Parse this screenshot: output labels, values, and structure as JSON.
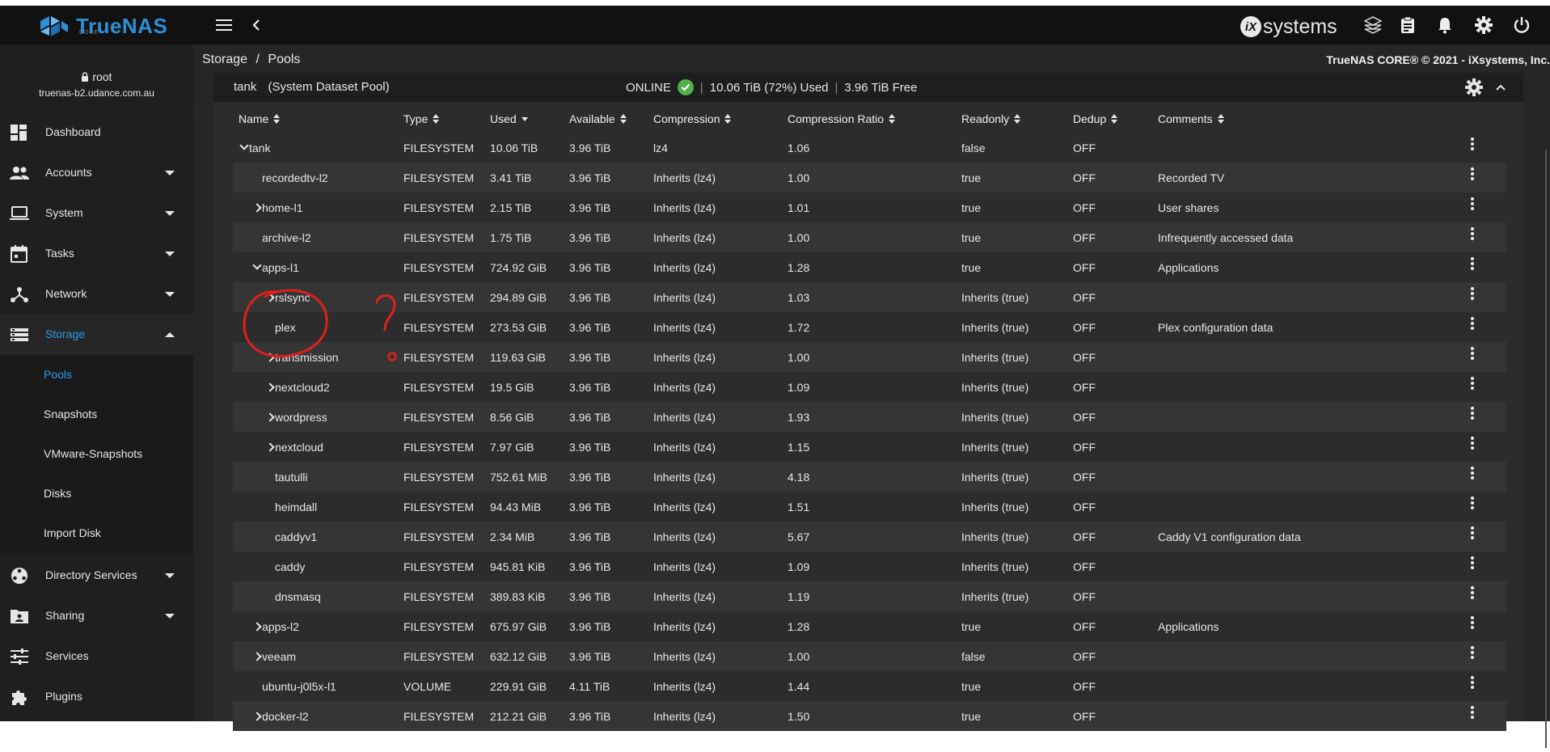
{
  "app": {
    "logo_text": "TrueNAS",
    "logo_sub": "CORE",
    "vendor_logo": "systems",
    "vendor_logo_mark": "iX"
  },
  "topbar": {
    "icons": [
      "menu-icon",
      "chevron-left-icon",
      "truecommand-icon",
      "clipboard-icon",
      "bell-icon",
      "gear-icon",
      "power-icon"
    ]
  },
  "user": {
    "name": "root",
    "host": "truenas-b2.udance.com.au"
  },
  "sidebar": {
    "items": [
      {
        "label": "Dashboard",
        "icon": "dashboard-icon",
        "has_caret": false
      },
      {
        "label": "Accounts",
        "icon": "accounts-icon",
        "has_caret": true
      },
      {
        "label": "System",
        "icon": "laptop-icon",
        "has_caret": true
      },
      {
        "label": "Tasks",
        "icon": "calendar-icon",
        "has_caret": true
      },
      {
        "label": "Network",
        "icon": "network-icon",
        "has_caret": true
      },
      {
        "label": "Storage",
        "icon": "storage-icon",
        "has_caret": true,
        "active": true
      }
    ],
    "storage_sub": [
      "Pools",
      "Snapshots",
      "VMware-Snapshots",
      "Disks",
      "Import Disk"
    ],
    "items_after": [
      {
        "label": "Directory Services",
        "icon": "directory-icon",
        "has_caret": true
      },
      {
        "label": "Sharing",
        "icon": "sharing-icon",
        "has_caret": true
      },
      {
        "label": "Services",
        "icon": "services-icon",
        "has_caret": false
      },
      {
        "label": "Plugins",
        "icon": "plugins-icon",
        "has_caret": false
      }
    ]
  },
  "breadcrumb": {
    "parent": "Storage",
    "separator": "/",
    "current": "Pools"
  },
  "copyright": "TrueNAS CORE® © 2021 - iXsystems, Inc.",
  "pool": {
    "name": "tank",
    "label": "(System Dataset Pool)",
    "status": "ONLINE",
    "used": "10.06 TiB (72%) Used",
    "free": "3.96 TiB Free"
  },
  "table": {
    "columns": [
      "Name",
      "Type",
      "Used",
      "Available",
      "Compression",
      "Compression Ratio",
      "Readonly",
      "Dedup",
      "Comments"
    ],
    "rows": [
      {
        "name": "tank",
        "expander": "down",
        "indent": 0,
        "type": "FILESYSTEM",
        "used": "10.06 TiB",
        "available": "3.96 TiB",
        "compression": "lz4",
        "ratio": "1.06",
        "readonly": "false",
        "dedup": "OFF",
        "comments": ""
      },
      {
        "name": "recordedtv-l2",
        "expander": "none",
        "indent": 1,
        "type": "FILESYSTEM",
        "used": "3.41 TiB",
        "available": "3.96 TiB",
        "compression": "Inherits (lz4)",
        "ratio": "1.00",
        "readonly": "true",
        "dedup": "OFF",
        "comments": "Recorded TV"
      },
      {
        "name": "home-l1",
        "expander": "right",
        "indent": 1,
        "type": "FILESYSTEM",
        "used": "2.15 TiB",
        "available": "3.96 TiB",
        "compression": "Inherits (lz4)",
        "ratio": "1.01",
        "readonly": "true",
        "dedup": "OFF",
        "comments": "User shares"
      },
      {
        "name": "archive-l2",
        "expander": "none",
        "indent": 1,
        "type": "FILESYSTEM",
        "used": "1.75 TiB",
        "available": "3.96 TiB",
        "compression": "Inherits (lz4)",
        "ratio": "1.00",
        "readonly": "true",
        "dedup": "OFF",
        "comments": "Infrequently accessed data"
      },
      {
        "name": "apps-l1",
        "expander": "down",
        "indent": 1,
        "type": "FILESYSTEM",
        "used": "724.92 GiB",
        "available": "3.96 TiB",
        "compression": "Inherits (lz4)",
        "ratio": "1.28",
        "readonly": "true",
        "dedup": "OFF",
        "comments": "Applications"
      },
      {
        "name": "rslsync",
        "expander": "right",
        "indent": 2,
        "type": "FILESYSTEM",
        "used": "294.89 GiB",
        "available": "3.96 TiB",
        "compression": "Inherits (lz4)",
        "ratio": "1.03",
        "readonly": "Inherits (true)",
        "dedup": "OFF",
        "comments": ""
      },
      {
        "name": "plex",
        "expander": "none",
        "indent": 2,
        "type": "FILESYSTEM",
        "used": "273.53 GiB",
        "available": "3.96 TiB",
        "compression": "Inherits (lz4)",
        "ratio": "1.72",
        "readonly": "Inherits (true)",
        "dedup": "OFF",
        "comments": "Plex configuration data"
      },
      {
        "name": "transmission",
        "expander": "right",
        "indent": 2,
        "type": "FILESYSTEM",
        "used": "119.63 GiB",
        "available": "3.96 TiB",
        "compression": "Inherits (lz4)",
        "ratio": "1.00",
        "readonly": "Inherits (true)",
        "dedup": "OFF",
        "comments": ""
      },
      {
        "name": "nextcloud2",
        "expander": "right",
        "indent": 2,
        "type": "FILESYSTEM",
        "used": "19.5 GiB",
        "available": "3.96 TiB",
        "compression": "Inherits (lz4)",
        "ratio": "1.09",
        "readonly": "Inherits (true)",
        "dedup": "OFF",
        "comments": ""
      },
      {
        "name": "wordpress",
        "expander": "right",
        "indent": 2,
        "type": "FILESYSTEM",
        "used": "8.56 GiB",
        "available": "3.96 TiB",
        "compression": "Inherits (lz4)",
        "ratio": "1.93",
        "readonly": "Inherits (true)",
        "dedup": "OFF",
        "comments": ""
      },
      {
        "name": "nextcloud",
        "expander": "right",
        "indent": 2,
        "type": "FILESYSTEM",
        "used": "7.97 GiB",
        "available": "3.96 TiB",
        "compression": "Inherits (lz4)",
        "ratio": "1.15",
        "readonly": "Inherits (true)",
        "dedup": "OFF",
        "comments": ""
      },
      {
        "name": "tautulli",
        "expander": "none",
        "indent": 2,
        "type": "FILESYSTEM",
        "used": "752.61 MiB",
        "available": "3.96 TiB",
        "compression": "Inherits (lz4)",
        "ratio": "4.18",
        "readonly": "Inherits (true)",
        "dedup": "OFF",
        "comments": ""
      },
      {
        "name": "heimdall",
        "expander": "none",
        "indent": 2,
        "type": "FILESYSTEM",
        "used": "94.43 MiB",
        "available": "3.96 TiB",
        "compression": "Inherits (lz4)",
        "ratio": "1.51",
        "readonly": "Inherits (true)",
        "dedup": "OFF",
        "comments": ""
      },
      {
        "name": "caddyv1",
        "expander": "none",
        "indent": 2,
        "type": "FILESYSTEM",
        "used": "2.34 MiB",
        "available": "3.96 TiB",
        "compression": "Inherits (lz4)",
        "ratio": "5.67",
        "readonly": "Inherits (true)",
        "dedup": "OFF",
        "comments": "Caddy V1 configuration data"
      },
      {
        "name": "caddy",
        "expander": "none",
        "indent": 2,
        "type": "FILESYSTEM",
        "used": "945.81 KiB",
        "available": "3.96 TiB",
        "compression": "Inherits (lz4)",
        "ratio": "1.09",
        "readonly": "Inherits (true)",
        "dedup": "OFF",
        "comments": ""
      },
      {
        "name": "dnsmasq",
        "expander": "none",
        "indent": 2,
        "type": "FILESYSTEM",
        "used": "389.83 KiB",
        "available": "3.96 TiB",
        "compression": "Inherits (lz4)",
        "ratio": "1.19",
        "readonly": "Inherits (true)",
        "dedup": "OFF",
        "comments": ""
      },
      {
        "name": "apps-l2",
        "expander": "right",
        "indent": 1,
        "type": "FILESYSTEM",
        "used": "675.97 GiB",
        "available": "3.96 TiB",
        "compression": "Inherits (lz4)",
        "ratio": "1.28",
        "readonly": "true",
        "dedup": "OFF",
        "comments": "Applications"
      },
      {
        "name": "veeam",
        "expander": "right",
        "indent": 1,
        "type": "FILESYSTEM",
        "used": "632.12 GiB",
        "available": "3.96 TiB",
        "compression": "Inherits (lz4)",
        "ratio": "1.00",
        "readonly": "false",
        "dedup": "OFF",
        "comments": ""
      },
      {
        "name": "ubuntu-j0l5x-l1",
        "expander": "none",
        "indent": 1,
        "type": "VOLUME",
        "used": "229.91 GiB",
        "available": "4.11 TiB",
        "compression": "Inherits (lz4)",
        "ratio": "1.44",
        "readonly": "true",
        "dedup": "OFF",
        "comments": ""
      },
      {
        "name": "docker-l2",
        "expander": "right",
        "indent": 1,
        "type": "FILESYSTEM",
        "used": "212.21 GiB",
        "available": "3.96 TiB",
        "compression": "Inherits (lz4)",
        "ratio": "1.50",
        "readonly": "true",
        "dedup": "OFF",
        "comments": ""
      }
    ]
  },
  "annotation": {
    "color": "#e0201c",
    "mark": "?"
  }
}
